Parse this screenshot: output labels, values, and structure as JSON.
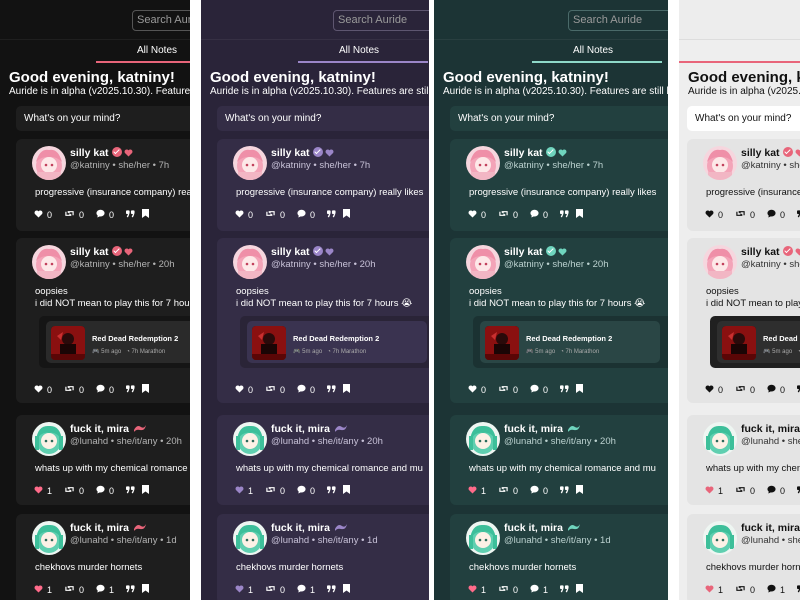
{
  "search": {
    "placeholder": "Search Auride"
  },
  "tabs": {
    "all_notes": "All Notes"
  },
  "home": {
    "greeting": "Good evening, katniny!",
    "alpha_notice": "Auride is in alpha (v2025.10.30). Features are still being",
    "composer_placeholder": "What's on your mind?"
  },
  "posts": [
    {
      "author": "silly kat",
      "handle": "@katniny • she/her • 7h",
      "text": "progressive (insurance company) really likes",
      "likes": "0",
      "renotes": "0",
      "replies": "0"
    },
    {
      "author": "silly kat",
      "handle": "@katniny • she/her • 20h",
      "text_line1": "oopsies",
      "text_line2": "i did NOT mean to play this for 7 hours 😭",
      "embed_title": "Red Dead Redemption 2",
      "embed_time": "5m ago",
      "embed_status": "7h Marathon",
      "likes": "0",
      "renotes": "0",
      "replies": "0"
    },
    {
      "author": "fuck it, mira",
      "handle": "@lunahd • she/it/any • 20h",
      "text": "whats up with my chemical romance and mu",
      "likes": "1",
      "renotes": "0",
      "replies": "0"
    },
    {
      "author": "fuck it, mira",
      "handle": "@lunahd • she/it/any • 1d",
      "text": "chekhovs murder hornets",
      "likes": "1",
      "renotes": "0",
      "replies": "1"
    }
  ],
  "themes": [
    {
      "name": "dark",
      "bg": "#121212",
      "card": "#1e1e1e",
      "text": "#ffffff",
      "muted": "#b4b4b4",
      "accent": "#e8657a",
      "badge": "#e8657a",
      "heart": "#ff6b8a",
      "ribbon": "#e8657a"
    },
    {
      "name": "purple",
      "bg": "#2a2439",
      "card": "#342d46",
      "text": "#ffffff",
      "muted": "#c8c2d8",
      "accent": "#9b86c8",
      "badge": "#9b86c8",
      "heart": "#9b86c8",
      "ribbon": "#9b86c8"
    },
    {
      "name": "teal",
      "bg": "#1c3435",
      "card": "#22403f",
      "text": "#ffffff",
      "muted": "#bcd2d0",
      "accent": "#8ed8c8",
      "badge": "#6fd4bd",
      "heart": "#ff6b8a",
      "ribbon": "#6fd4bd"
    },
    {
      "name": "light",
      "bg": "#eeeeee",
      "card": "#e4e4e4",
      "text": "#111111",
      "muted": "#333333",
      "accent": "#e8657a",
      "badge": "#e8657a",
      "heart": "#e8657a",
      "ribbon": "#e8657a"
    }
  ]
}
